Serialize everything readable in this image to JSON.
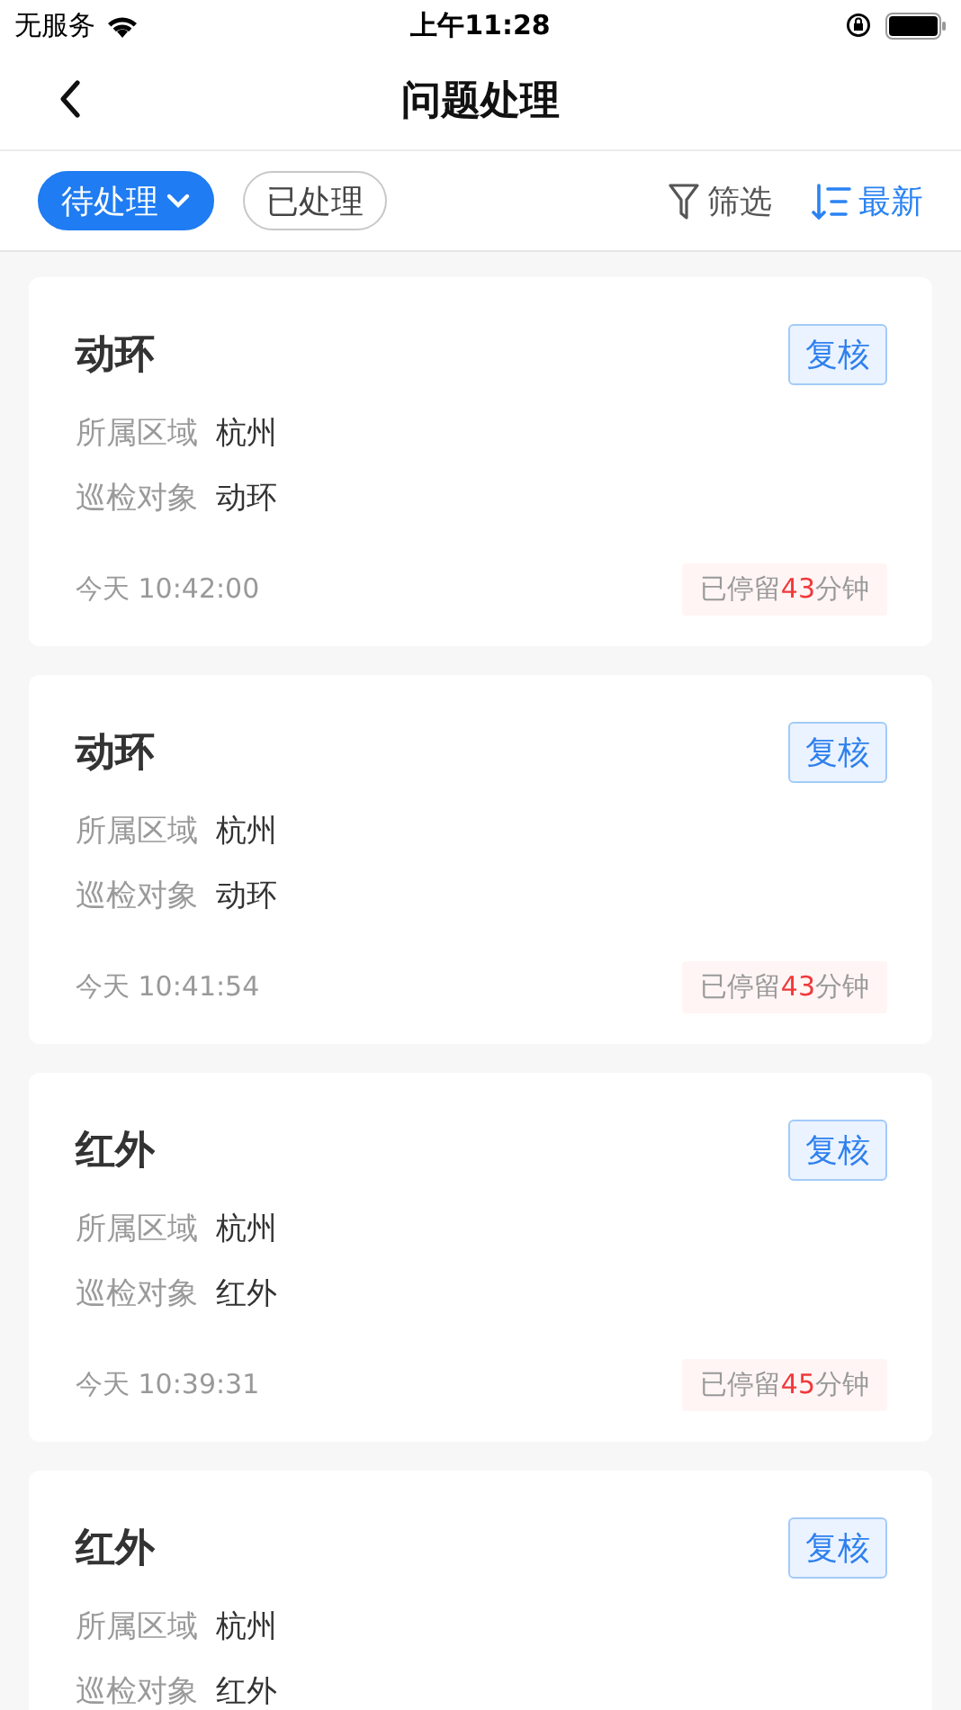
{
  "status_bar": {
    "carrier": "无服务",
    "time": "上午11:28"
  },
  "nav": {
    "title": "问题处理"
  },
  "tabs": [
    {
      "label": "待处理",
      "selected": true,
      "dropdown": true
    },
    {
      "label": "已处理",
      "selected": false,
      "dropdown": false
    }
  ],
  "tools": [
    {
      "kind": "filter",
      "label": "筛选",
      "active": false
    },
    {
      "kind": "sort",
      "label": "最新",
      "active": true
    }
  ],
  "cards": [
    {
      "title": "动环",
      "action": "复核",
      "fields": [
        {
          "label": "所属区域",
          "value": "杭州"
        },
        {
          "label": "巡检对象",
          "value": "动环"
        }
      ],
      "time": "今天 10:42:00",
      "stay": {
        "prefix": "已停留",
        "minutes": "43",
        "suffix": "分钟"
      }
    },
    {
      "title": "动环",
      "action": "复核",
      "fields": [
        {
          "label": "所属区域",
          "value": "杭州"
        },
        {
          "label": "巡检对象",
          "value": "动环"
        }
      ],
      "time": "今天 10:41:54",
      "stay": {
        "prefix": "已停留",
        "minutes": "43",
        "suffix": "分钟"
      }
    },
    {
      "title": "红外",
      "action": "复核",
      "fields": [
        {
          "label": "所属区域",
          "value": "杭州"
        },
        {
          "label": "巡检对象",
          "value": "红外"
        }
      ],
      "time": "今天 10:39:31",
      "stay": {
        "prefix": "已停留",
        "minutes": "45",
        "suffix": "分钟"
      }
    },
    {
      "title": "红外",
      "action": "复核",
      "fields": [
        {
          "label": "所属区域",
          "value": "杭州"
        },
        {
          "label": "巡检对象",
          "value": "红外"
        }
      ]
    }
  ]
}
